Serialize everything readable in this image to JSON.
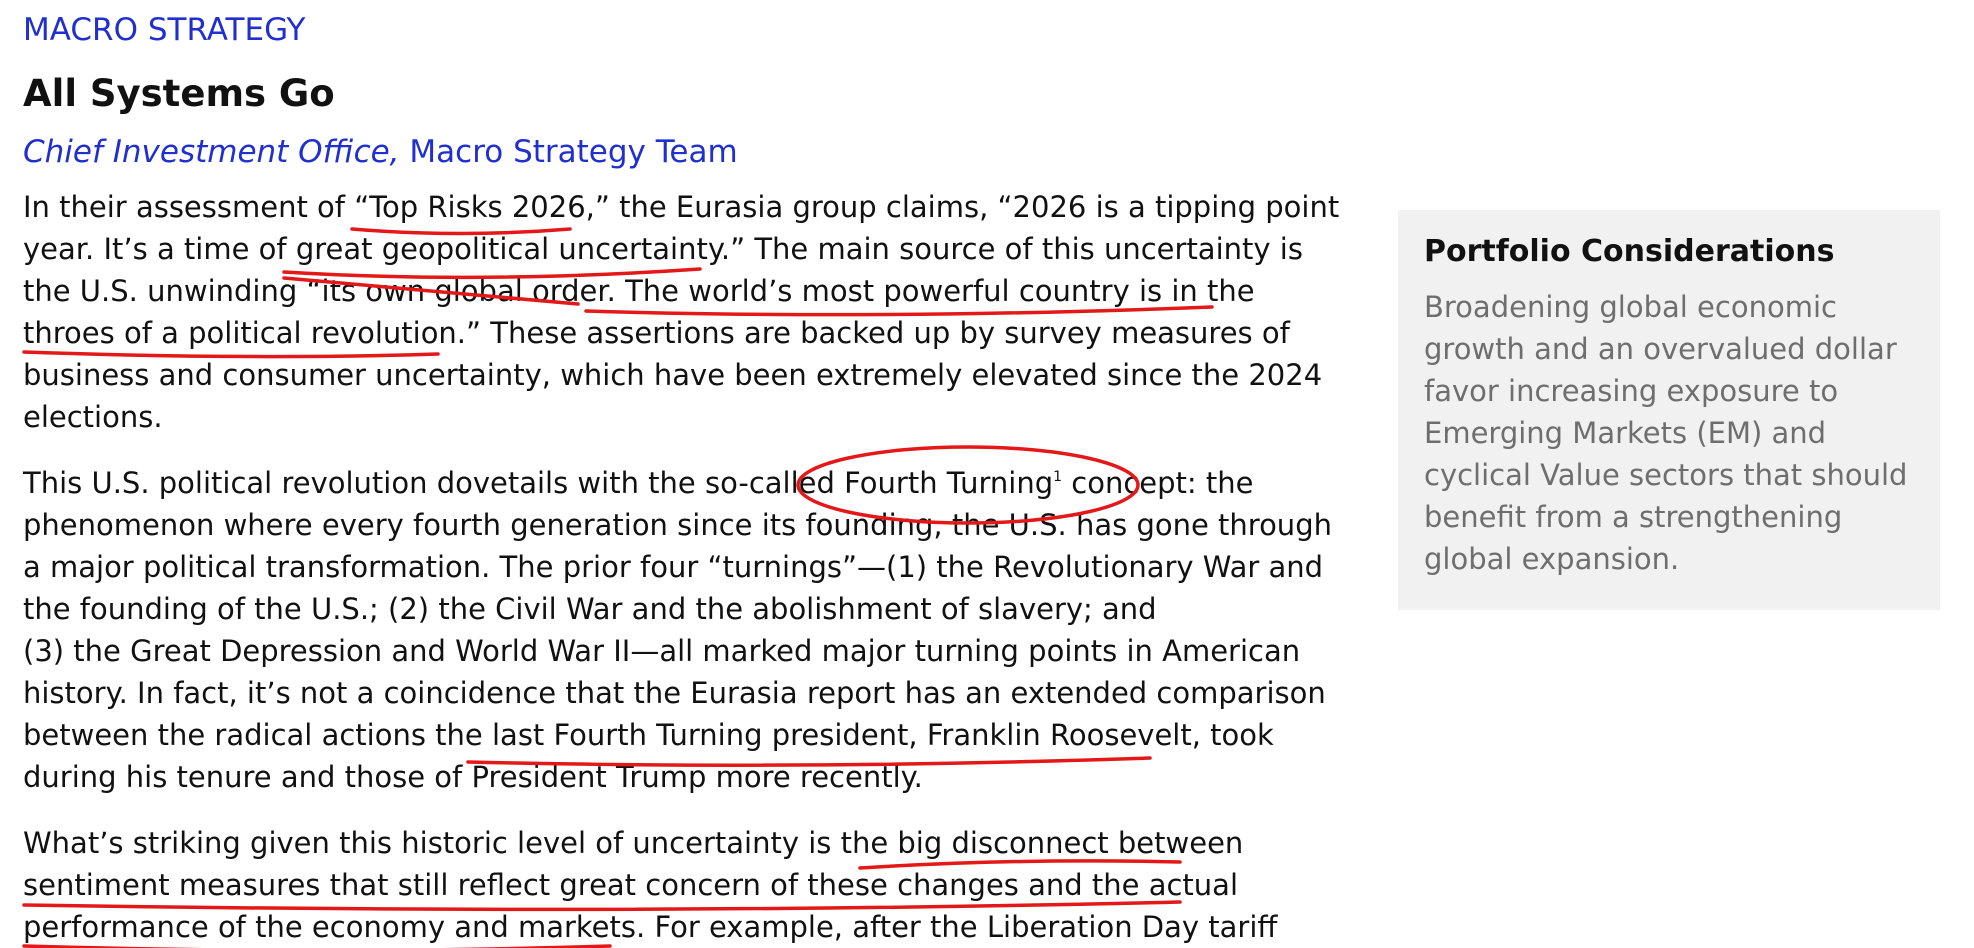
{
  "header": {
    "kicker": "MACRO STRATEGY",
    "title": "All Systems Go",
    "byline_italic": "Chief Investment Office,",
    "byline_rest": " Macro Strategy Team"
  },
  "body": {
    "p1": [
      "In their assessment of “Top Risks 2026,” the Eurasia group claims, “2026 is a tipping point",
      "year. It’s a time of great geopolitical uncertainty.” The main source of this uncertainty is",
      "the U.S. unwinding “its own global order. The world’s most powerful country is in the",
      "throes of a political revolution.” These assertions are backed up by survey measures of",
      "business and consumer uncertainty, which have been extremely elevated since the 2024",
      "elections."
    ],
    "p2": {
      "first_before": "This U.S. political revolution dovetails with the so-called Fourth Turning",
      "footnote_ref": "1",
      "first_after": " concept: the",
      "lines": [
        "phenomenon where every fourth generation since its founding, the U.S. has gone through",
        "a major political transformation. The prior four “turnings”—(1) the Revolutionary War and",
        "the founding of the U.S.; (2) the Civil War and the abolishment of slavery; and",
        "(3) the Great Depression and World War II—all marked major turning points in American",
        "history. In fact, it’s not a coincidence that the Eurasia report has an extended comparison",
        "between the radical actions the last Fourth Turning president, Franklin Roosevelt, took",
        "during his tenure and those of President Trump more recently."
      ]
    },
    "p3": [
      "What’s striking given this historic level of uncertainty is the big disconnect between",
      "sentiment measures that still reflect great concern of these changes and the actual",
      "performance of the economy and markets. For example, after the Liberation Day tariff"
    ]
  },
  "sidebar": {
    "heading": "Portfolio Considerations",
    "lines": [
      "Broadening global economic",
      "growth and an overvalued dollar",
      "favor increasing exposure to",
      "Emerging Markets (EM) and",
      "cyclical Value sectors that should",
      "benefit from a strengthening",
      "global expansion."
    ]
  },
  "colors": {
    "accent": "#1f2fd0",
    "annotation": "#e41818",
    "sidebar_bg": "#f1f1f1",
    "sidebar_text": "#6e6e6e"
  }
}
